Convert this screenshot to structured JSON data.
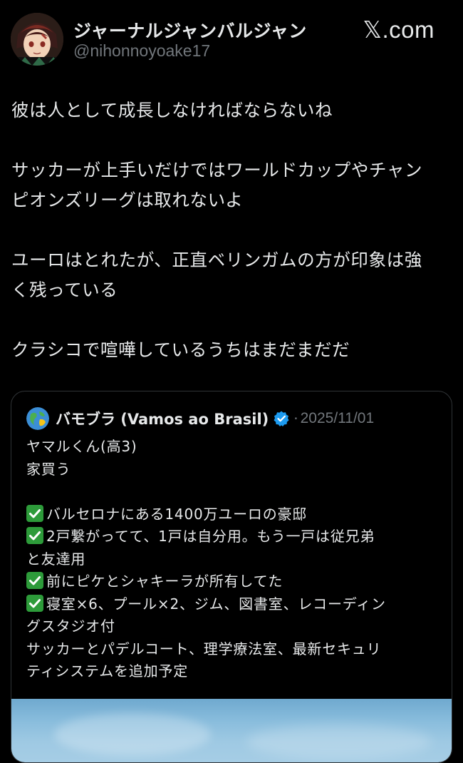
{
  "author": {
    "name": "ジャーナルジャンバルジャン",
    "handle": "@nihonnoyoake17",
    "avatar_icon": "anime-character-avatar"
  },
  "brand": {
    "label": "𝕏.com",
    "logo_icon": "x-logo-icon"
  },
  "tweet": {
    "paragraphs": [
      [
        "彼は人として成長しなければならないね"
      ],
      [
        "サッカーが上手いだけではワールドカップやチャン",
        "ピオンズリーグは取れないよ"
      ],
      [
        "ユーロはとれたが、正直ベリンガムの方が印象は強",
        "く残っている"
      ],
      [
        "クラシコで喧嘩しているうちはまだまだだ"
      ]
    ]
  },
  "quote": {
    "name": "バモブラ (Vamos ao Brasil)",
    "separator": "·",
    "date": "2025/11/01",
    "avatar_icon": "globe-avatar-icon",
    "verified_icon": "verified-badge-icon",
    "lines": [
      {
        "check": false,
        "text": "ヤマルくん(高3)"
      },
      {
        "check": false,
        "text": "家買う"
      },
      {
        "check": false,
        "text": ""
      },
      {
        "check": true,
        "text": "バルセロナにある1400万ユーロの豪邸"
      },
      {
        "check": true,
        "text": "2戸繋がってて、1戸は自分用。もう一戸は従兄弟"
      },
      {
        "check": false,
        "text": "と友達用"
      },
      {
        "check": true,
        "text": "前にピケとシャキーラが所有してた"
      },
      {
        "check": true,
        "text": "寝室×6、プール×2、ジム、図書室、レコーディン"
      },
      {
        "check": false,
        "text": "グスタジオ付"
      },
      {
        "check": false,
        "text": "サッカーとパデルコート、理学療法室、最新セキュリ"
      },
      {
        "check": false,
        "text": "ティシステムを追加予定"
      }
    ]
  },
  "colors": {
    "background": "#000000",
    "text": "#e7e9ea",
    "secondary": "#71767b",
    "verified": "#1d9bf0",
    "check": "#2d9b3a",
    "border": "#2f3336"
  }
}
